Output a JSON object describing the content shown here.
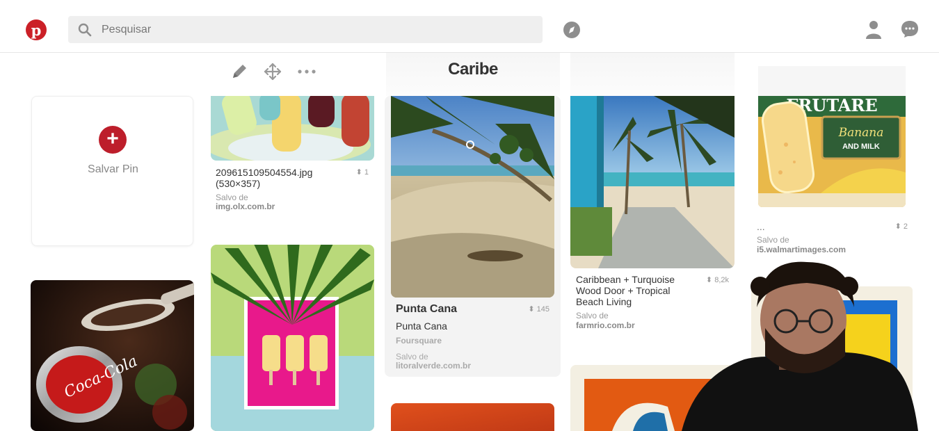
{
  "header": {
    "logo_letter": "p",
    "search_placeholder": "Pesquisar"
  },
  "board": {
    "title": "Caribe"
  },
  "save_card": {
    "plus": "+",
    "label": "Salvar Pin"
  },
  "pins": [
    {
      "title": "209615109504554.jpg (530×357)",
      "repins": "1",
      "saved_from_label": "Salvo de",
      "source": "img.olx.com.br"
    },
    {
      "title": "Punta Cana",
      "subtitle": "Punta Cana",
      "place_source": "Foursquare",
      "repins": "145",
      "saved_from_label": "Salvo de",
      "source": "litoralverde.com.br"
    },
    {
      "title": "Caribbean + Turquoise Wood Door + Tropical Beach Living",
      "repins": "8,2k",
      "saved_from_label": "Salvo de",
      "source": "farmrio.com.br"
    },
    {
      "title": "...",
      "repins": "2",
      "saved_from_label": "Salvo de",
      "source": "i5.walmartimages.com"
    }
  ],
  "image_text": {
    "frutare": "FRUTARE",
    "flavor": "Banana",
    "and_milk": "AND MILK",
    "coca_cola": "Coca-Cola"
  },
  "colors": {
    "brand_red": "#cb2027",
    "plus_red": "#bd1e2b"
  }
}
